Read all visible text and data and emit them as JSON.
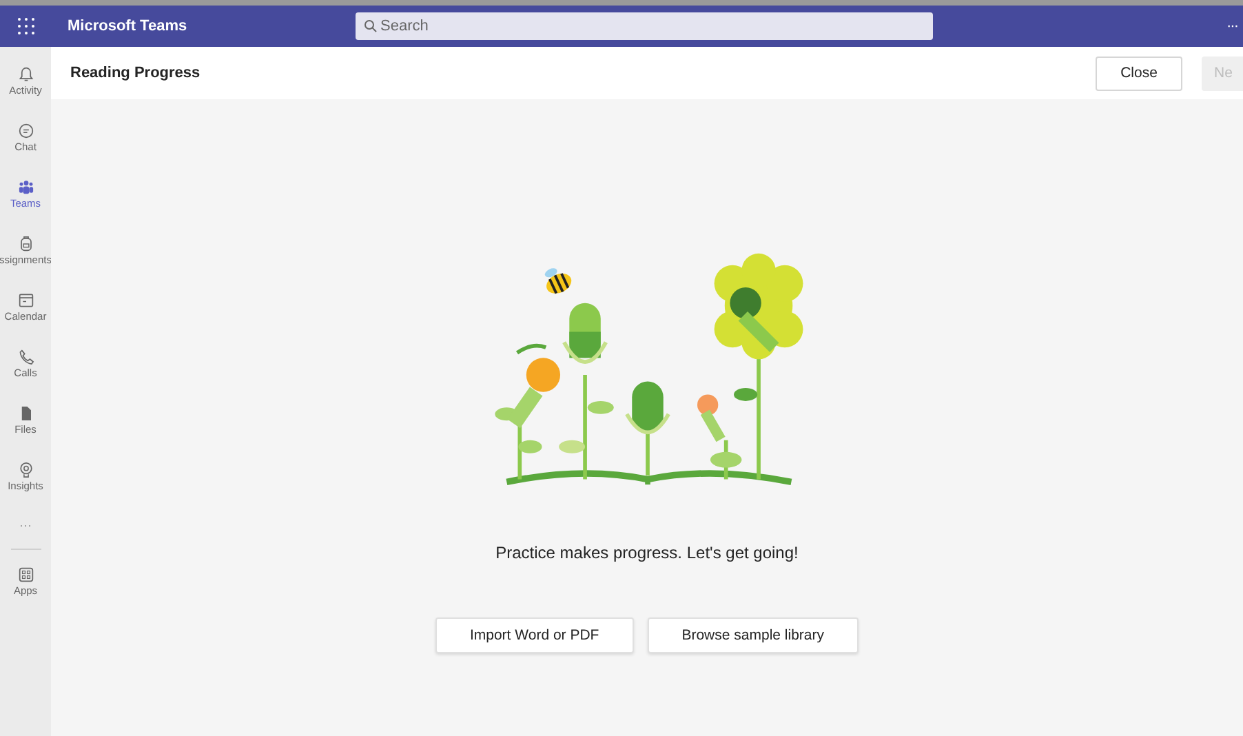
{
  "app_bar": {
    "title": "Microsoft Teams",
    "search": {
      "placeholder": "Search"
    },
    "more": "···"
  },
  "rail": {
    "items": [
      {
        "label": "Activity",
        "selected": false
      },
      {
        "label": "Chat",
        "selected": false
      },
      {
        "label": "Teams",
        "selected": true
      },
      {
        "label": "ssignments",
        "selected": false
      },
      {
        "label": "Calendar",
        "selected": false
      },
      {
        "label": "Calls",
        "selected": false
      },
      {
        "label": "Files",
        "selected": false
      },
      {
        "label": "Insights",
        "selected": false
      }
    ],
    "more": "···",
    "apps": {
      "label": "Apps",
      "selected": false
    }
  },
  "header": {
    "title": "Reading Progress",
    "buttons": [
      {
        "label": "Close",
        "disabled": false
      },
      {
        "label": "Ne",
        "disabled": true
      }
    ]
  },
  "content": {
    "message": "Practice makes progress. Let's get going!",
    "buttons": [
      "Import Word or PDF",
      "Browse sample library"
    ]
  }
}
